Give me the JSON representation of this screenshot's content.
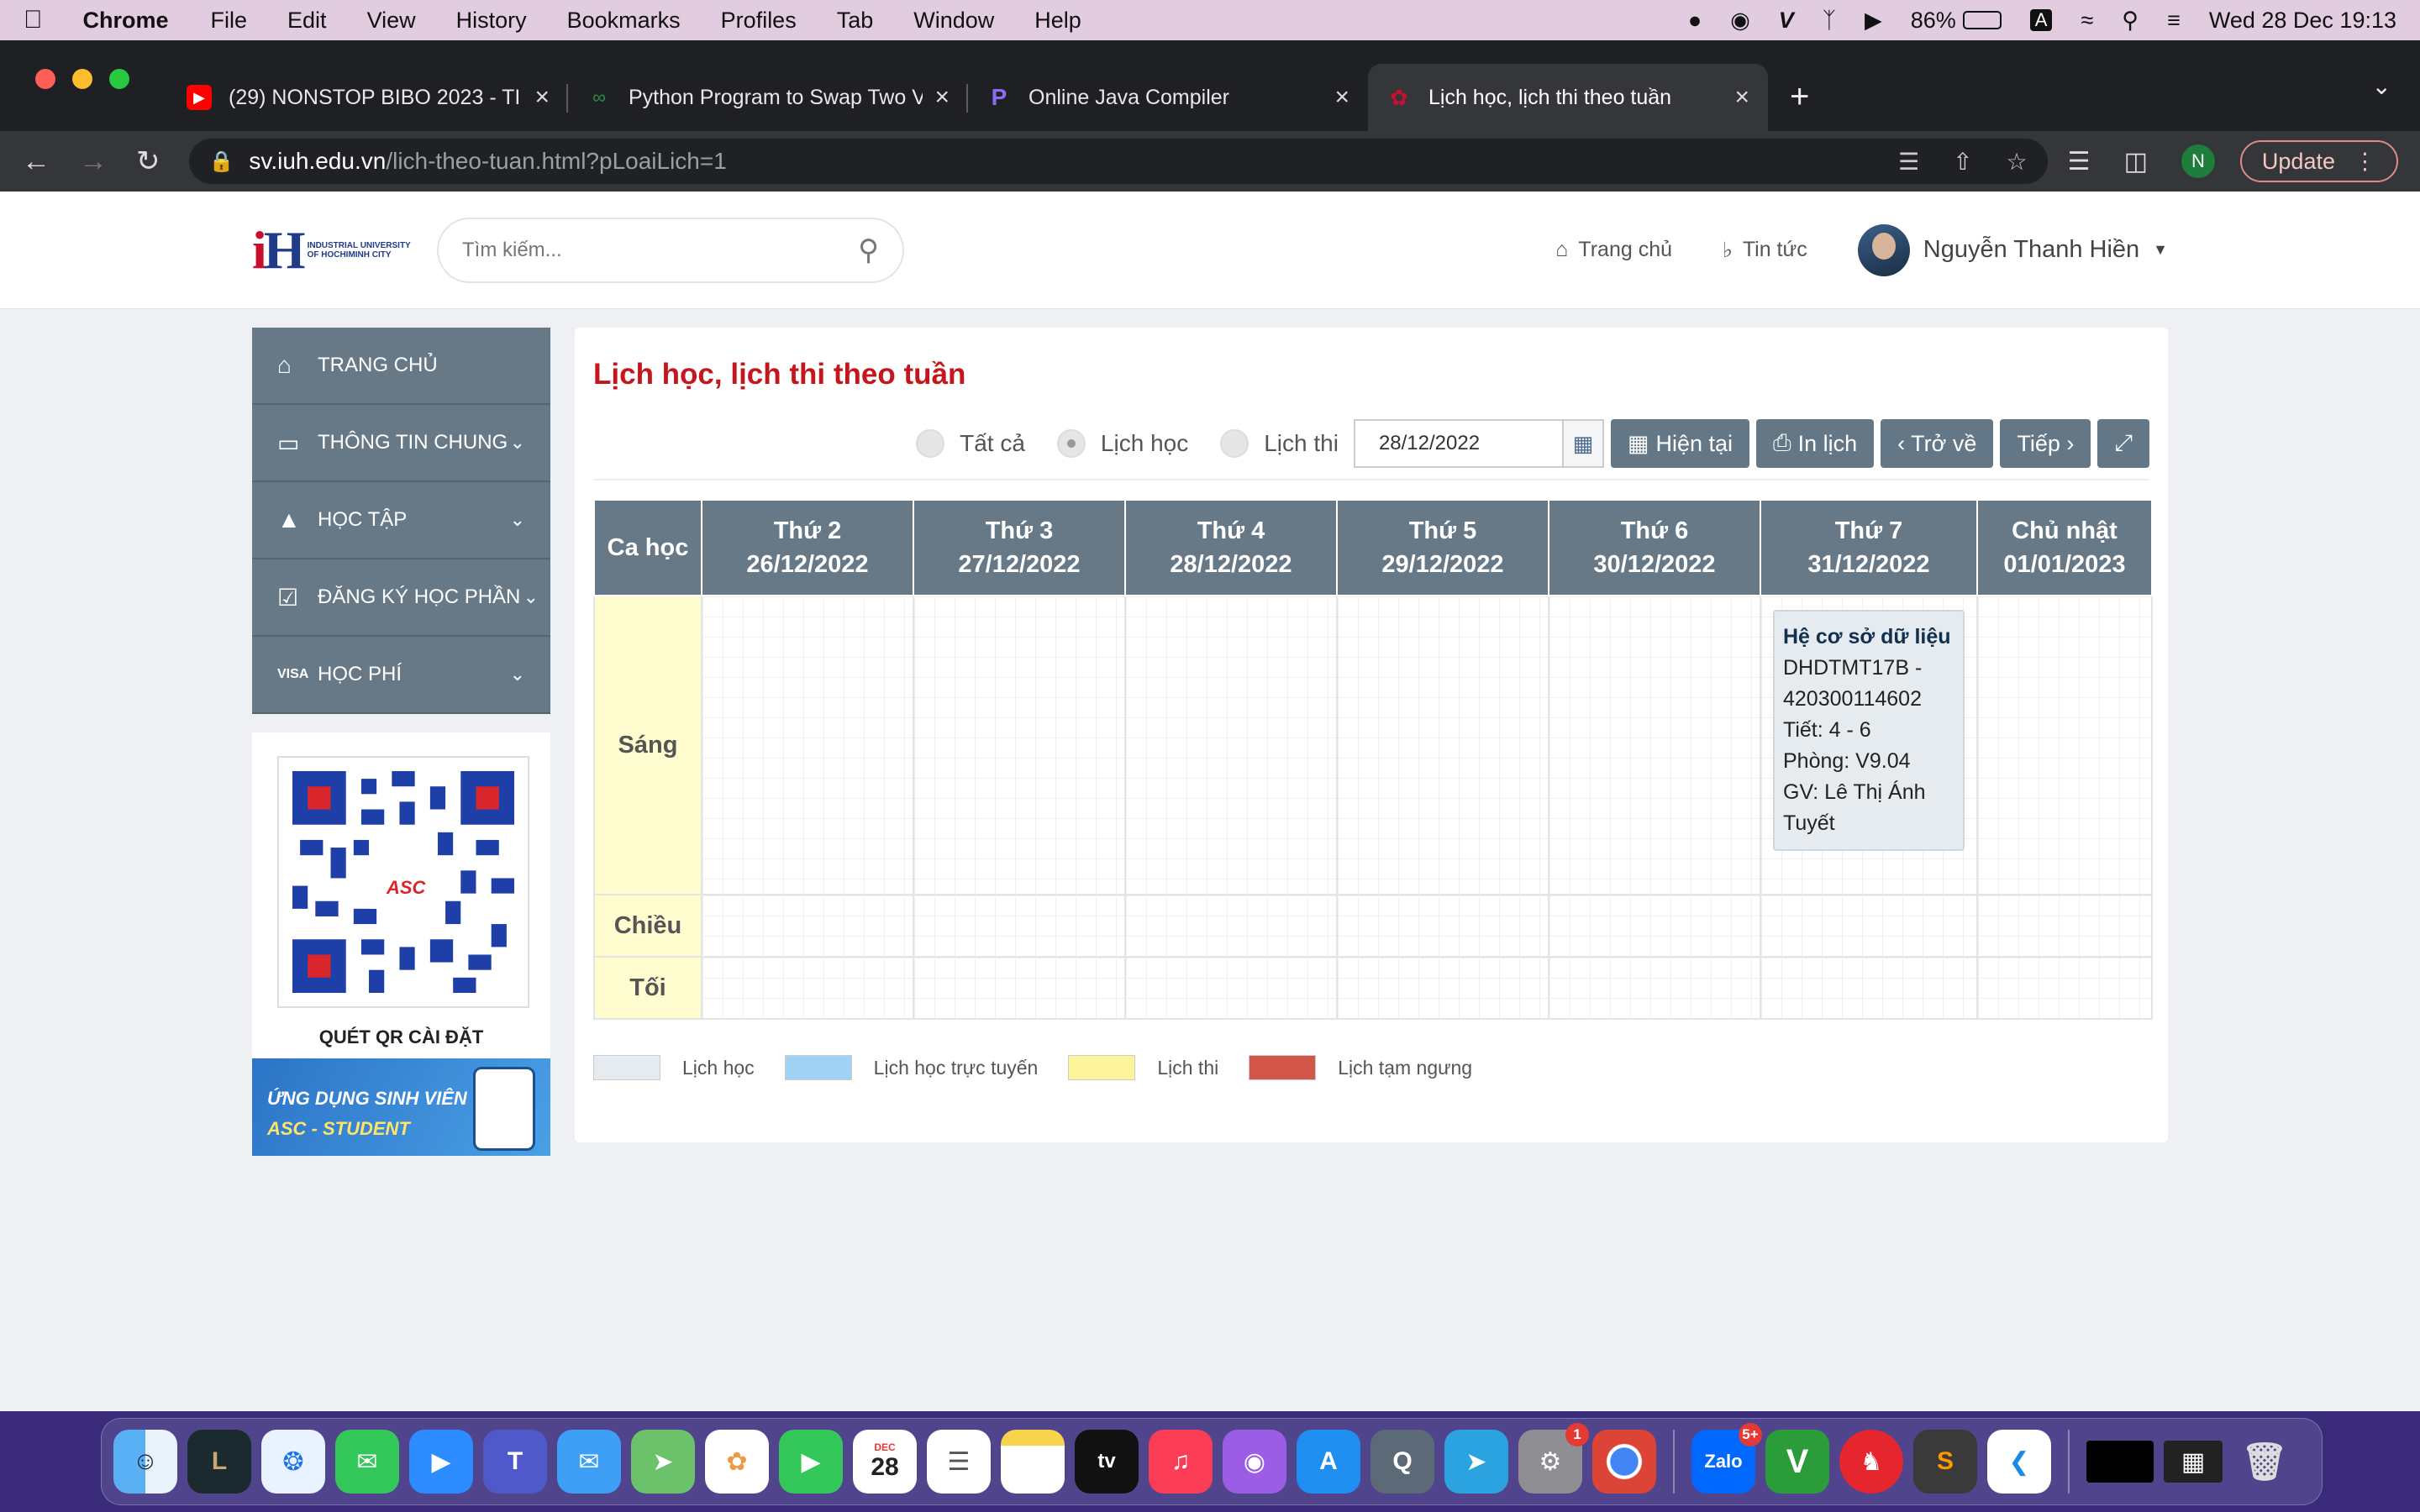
{
  "menubar": {
    "app": "Chrome",
    "items": [
      "File",
      "Edit",
      "View",
      "History",
      "Bookmarks",
      "Profiles",
      "Tab",
      "Window",
      "Help"
    ],
    "battery": "86%",
    "input_source": "A",
    "datetime": "Wed 28 Dec  19:13"
  },
  "tabs": [
    {
      "title": "(29) NONSTOP BIBO 2023 - TI",
      "favicon": "youtube-icon"
    },
    {
      "title": "Python Program to Swap Two V",
      "favicon": "geeksforgeeks-icon"
    },
    {
      "title": "Online Java Compiler",
      "favicon": "programiz-icon"
    },
    {
      "title": "Lịch học, lịch thi theo tuần",
      "favicon": "iuh-icon"
    }
  ],
  "address": {
    "host": "sv.iuh.edu.vn",
    "path": "/lich-theo-tuan.html?pLoaiLich=1"
  },
  "profile_initial": "N",
  "update_label": "Update",
  "header": {
    "logo_text": "INDUSTRIAL UNIVERSITY OF HOCHIMINH CITY",
    "search_placeholder": "Tìm kiếm...",
    "home_label": "Trang chủ",
    "news_label": "Tin tức",
    "user_name": "Nguyễn Thanh Hiền"
  },
  "sidebar": {
    "items": [
      {
        "label": "TRANG CHỦ",
        "icon": "home-icon"
      },
      {
        "label": "THÔNG TIN CHUNG",
        "icon": "monitor-icon"
      },
      {
        "label": "HỌC TẬP",
        "icon": "graduation-cap-icon"
      },
      {
        "label": "ĐĂNG KÝ HỌC PHẦN",
        "icon": "checkbox-icon"
      },
      {
        "label": "HỌC PHÍ",
        "icon": "visa-card-icon"
      }
    ],
    "qr_label": "QUÉT QR CÀI ĐẶT",
    "qr_center": "ASC",
    "banner_line1": "ỨNG DỤNG SINH VIÊN",
    "banner_line2": "ASC - STUDENT"
  },
  "schedule": {
    "title": "Lịch học, lịch thi theo tuần",
    "filters": [
      {
        "label": "Tất cả",
        "checked": false
      },
      {
        "label": "Lịch học",
        "checked": true
      },
      {
        "label": "Lịch thi",
        "checked": false
      }
    ],
    "date": "28/12/2022",
    "buttons": {
      "current": "Hiện tại",
      "print": "In lịch",
      "back": "‹ Trở về",
      "next": "Tiếp ›"
    },
    "shift_header": "Ca học",
    "days": [
      {
        "name": "Thứ 2",
        "date": "26/12/2022"
      },
      {
        "name": "Thứ 3",
        "date": "27/12/2022"
      },
      {
        "name": "Thứ 4",
        "date": "28/12/2022"
      },
      {
        "name": "Thứ 5",
        "date": "29/12/2022"
      },
      {
        "name": "Thứ 6",
        "date": "30/12/2022"
      },
      {
        "name": "Thứ 7",
        "date": "31/12/2022"
      },
      {
        "name": "Chủ nhật",
        "date": "01/01/2023"
      }
    ],
    "shifts": [
      "Sáng",
      "Chiều",
      "Tối"
    ],
    "class": {
      "name": "Hệ cơ sở dữ liệu",
      "code": "DHDTMT17B - 420300114602",
      "periods": "Tiết: 4 - 6",
      "room": "Phòng: V9.04",
      "teacher": "GV: Lê Thị Ánh Tuyết"
    },
    "legend": [
      {
        "label": "Lịch học",
        "color": "#e6ebf0"
      },
      {
        "label": "Lịch học trực tuyến",
        "color": "#9fd2f5"
      },
      {
        "label": "Lịch thi",
        "color": "#fdf59b"
      },
      {
        "label": "Lịch tạm ngưng",
        "color": "#d2574a"
      }
    ]
  },
  "dock": {
    "calendar_month": "DEC",
    "calendar_day": "28",
    "zalo_badge": "5+",
    "settings_badge": "1",
    "zalo_label": "Zalo"
  }
}
